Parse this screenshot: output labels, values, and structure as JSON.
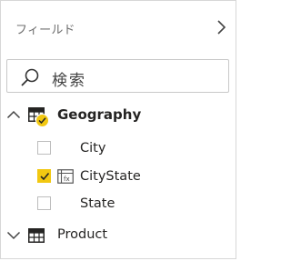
{
  "pane": {
    "title": "フィールド",
    "search_placeholder": "検索"
  },
  "tables": [
    {
      "name": "Geography",
      "expanded": true,
      "fields": [
        {
          "name": "City",
          "checked": false
        },
        {
          "name": "CityState",
          "checked": true
        },
        {
          "name": "State",
          "checked": false
        }
      ]
    },
    {
      "name": "Product",
      "expanded": false
    }
  ],
  "colors": {
    "accent_yellow": "#f2c811",
    "text": "#252423",
    "muted": "#6f6f6f",
    "border": "#d7d7d7"
  },
  "icons": [
    "chevron-right-icon",
    "search-icon",
    "chevron-up-icon",
    "table-icon",
    "checkmark-badge-icon",
    "checkbox-icon",
    "category-field-icon",
    "chevron-down-icon"
  ]
}
